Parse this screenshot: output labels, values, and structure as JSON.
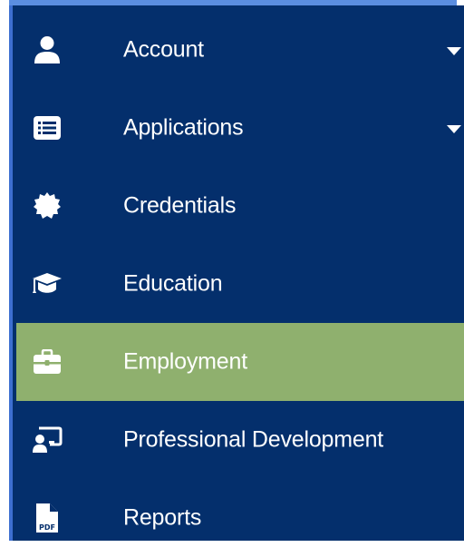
{
  "colors": {
    "sidebar_bg": "#042f6c",
    "active_bg": "#8fb06e",
    "text": "#ffffff"
  },
  "menu": {
    "items": [
      {
        "label": "Account",
        "icon": "user-icon",
        "expandable": true
      },
      {
        "label": "Applications",
        "icon": "list-icon",
        "expandable": true
      },
      {
        "label": "Credentials",
        "icon": "badge-certificate-icon",
        "expandable": false
      },
      {
        "label": "Education",
        "icon": "graduation-cap-icon",
        "expandable": false
      },
      {
        "label": "Employment",
        "icon": "briefcase-icon",
        "expandable": false,
        "active": true
      },
      {
        "label": "Professional Development",
        "icon": "presentation-icon",
        "expandable": false
      },
      {
        "label": "Reports",
        "icon": "pdf-file-icon",
        "expandable": false
      }
    ]
  }
}
